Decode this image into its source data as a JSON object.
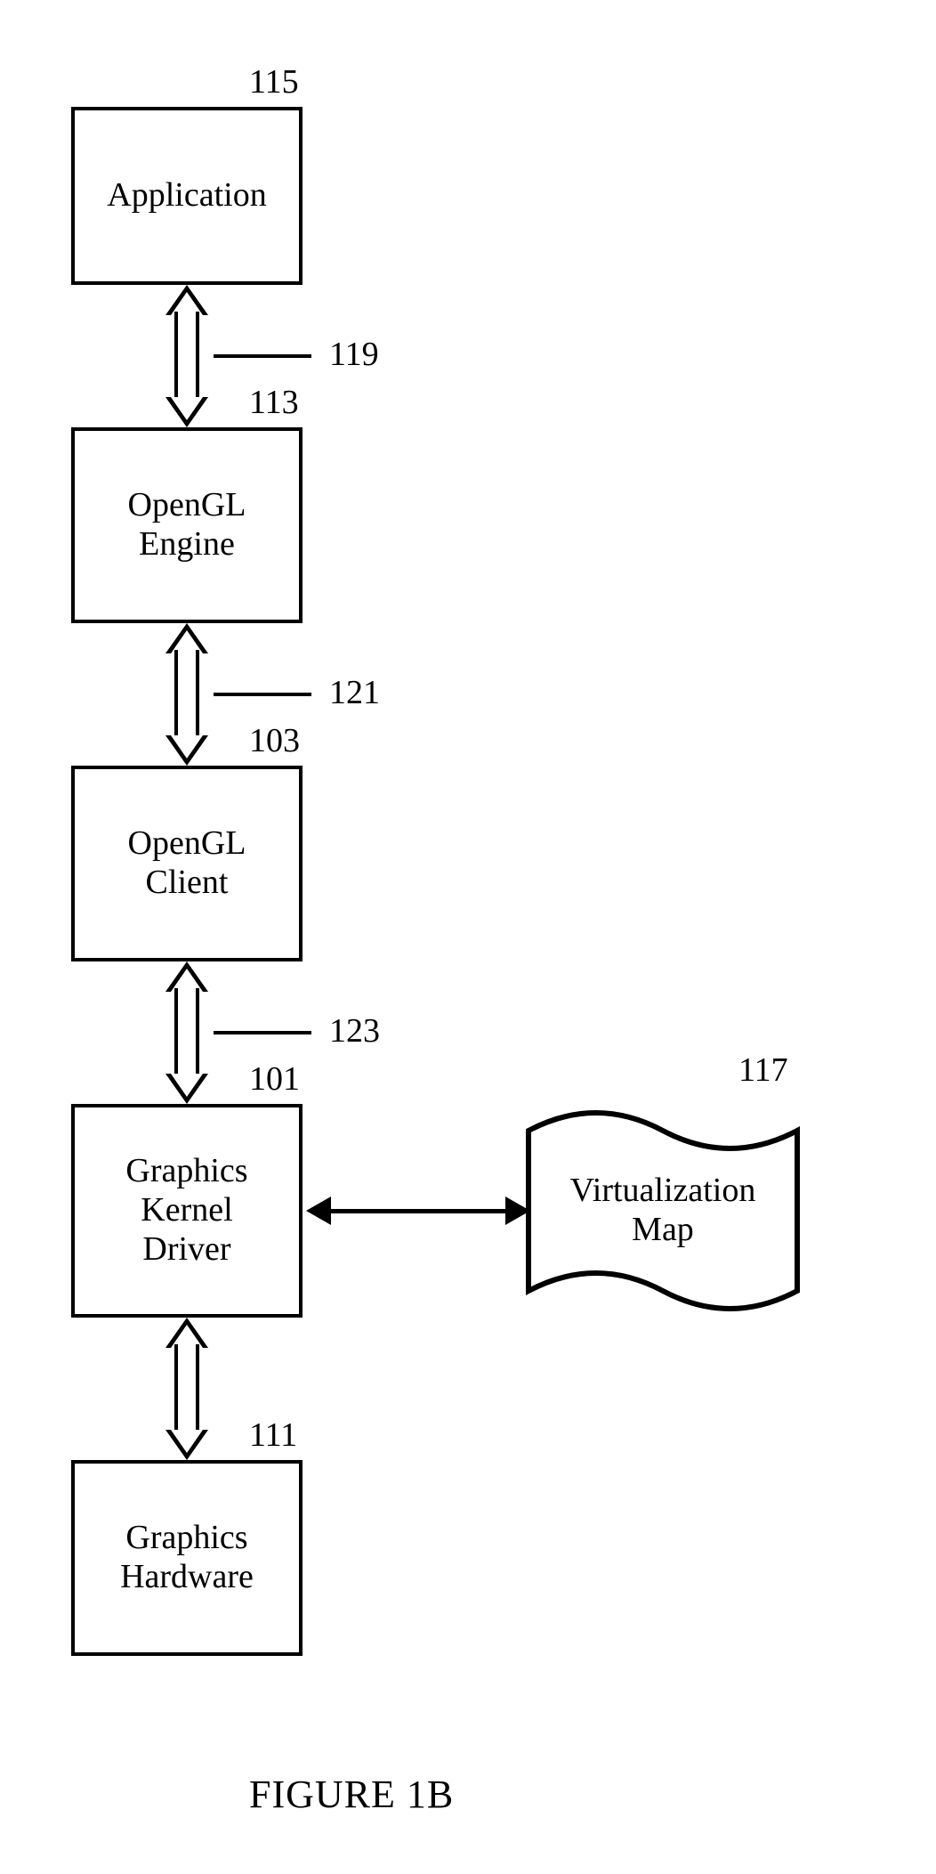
{
  "boxes": {
    "application": "Application",
    "opengl_engine": "OpenGL\nEngine",
    "opengl_client": "OpenGL\nClient",
    "graphics_kernel_driver": "Graphics\nKernel\nDriver",
    "graphics_hardware": "Graphics\nHardware",
    "virtualization_map": "Virtualization\nMap"
  },
  "labels": {
    "n115": "115",
    "n113": "113",
    "n103": "103",
    "n101": "101",
    "n111": "111",
    "n117": "117",
    "n119": "119",
    "n121": "121",
    "n123": "123"
  },
  "caption": "FIGURE 1B"
}
